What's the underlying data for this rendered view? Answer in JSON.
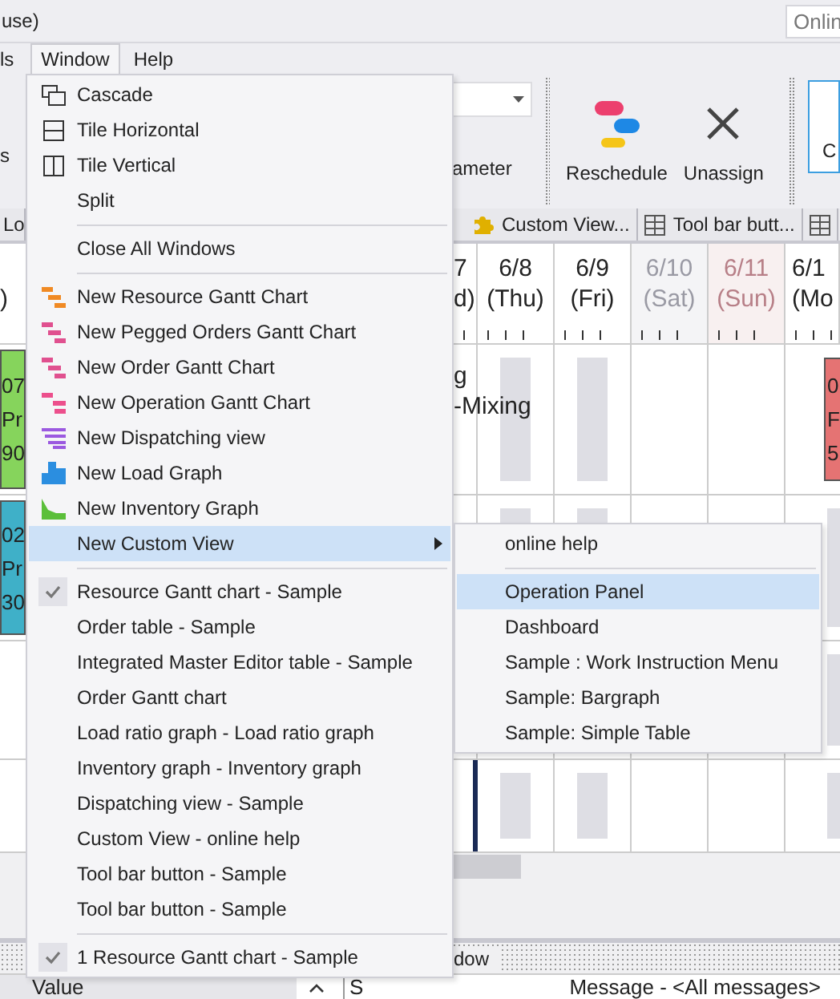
{
  "title_bar": {
    "text": "use)",
    "online_field": "Onlin"
  },
  "menubar": [
    {
      "label": "ls",
      "selected": false
    },
    {
      "label": "Window",
      "selected": true
    },
    {
      "label": "Help",
      "selected": false
    }
  ],
  "toolbar": {
    "left_fragment": "s",
    "param_fragment": "ameter",
    "buttons": [
      {
        "label": "Reschedule",
        "kind": "reschedule"
      },
      {
        "label": "Unassign",
        "kind": "unassign"
      },
      {
        "label": "C",
        "kind": "partial"
      }
    ]
  },
  "doc_tabs": [
    {
      "label": "Lo",
      "kind": "plain"
    },
    {
      "label": "Custom View...",
      "kind": "custom"
    },
    {
      "label": "Tool bar butt...",
      "kind": "table"
    },
    {
      "kind": "table"
    }
  ],
  "gantt": {
    "left_fragment": ")",
    "dates": [
      {
        "date": "7",
        "day": "d)",
        "kind": "weekday"
      },
      {
        "date": "6/8",
        "day": "(Thu)",
        "kind": "weekday"
      },
      {
        "date": "6/9",
        "day": "(Fri)",
        "kind": "weekday"
      },
      {
        "date": "6/10",
        "day": "(Sat)",
        "kind": "saturday"
      },
      {
        "date": "6/11",
        "day": "(Sun)",
        "kind": "sunday"
      },
      {
        "date": "6/1",
        "day": "(Mo",
        "kind": "weekday"
      }
    ],
    "rows": [
      {
        "left_bar": {
          "color": "#86d45c",
          "lines": [
            "07",
            "Pr",
            "90"
          ]
        },
        "texts": [
          "g",
          "-Mixing"
        ],
        "right_bar": {
          "color": "#e57373",
          "lines": [
            "0",
            "F",
            "5"
          ]
        }
      },
      {
        "left_bar": {
          "color": "#3fb0c8",
          "lines": [
            "02",
            "Pr",
            "30"
          ]
        }
      }
    ]
  },
  "dock_title": "dow",
  "bottom": {
    "value_header": "Value",
    "s_header": "S",
    "message": "Message - <All messages>"
  },
  "window_menu": {
    "sections": [
      [
        {
          "label": "Cascade",
          "kind": "cascade",
          "checked": false,
          "submenu": false,
          "selected": false
        },
        {
          "label": "Tile Horizontal",
          "kind": "tile-horizontal",
          "checked": false,
          "submenu": false,
          "selected": false
        },
        {
          "label": "Tile Vertical",
          "kind": "tile-vertical",
          "checked": false,
          "submenu": false,
          "selected": false
        },
        {
          "label": "Split",
          "kind": "plain",
          "checked": false,
          "submenu": false,
          "selected": false
        }
      ],
      [
        {
          "label": "Close All Windows",
          "kind": "plain",
          "checked": false,
          "submenu": false,
          "selected": false
        }
      ],
      [
        {
          "label": "New Resource Gantt Chart",
          "kind": "resource",
          "checked": false,
          "submenu": false,
          "selected": false
        },
        {
          "label": "New Pegged Orders Gantt Chart",
          "kind": "pegged",
          "checked": false,
          "submenu": false,
          "selected": false
        },
        {
          "label": "New Order Gantt Chart",
          "kind": "order",
          "checked": false,
          "submenu": false,
          "selected": false
        },
        {
          "label": "New Operation Gantt Chart",
          "kind": "operation",
          "checked": false,
          "submenu": false,
          "selected": false
        },
        {
          "label": "New Dispatching view",
          "kind": "dispatch",
          "checked": false,
          "submenu": false,
          "selected": false
        },
        {
          "label": "New Load Graph",
          "kind": "load",
          "checked": false,
          "submenu": false,
          "selected": false
        },
        {
          "label": "New Inventory Graph",
          "kind": "inventory",
          "checked": false,
          "submenu": false,
          "selected": false
        },
        {
          "label": "New Custom View",
          "kind": "plain",
          "checked": false,
          "submenu": true,
          "selected": true
        }
      ],
      [
        {
          "label": "Resource Gantt chart - Sample",
          "kind": "plain",
          "checked": true,
          "submenu": false,
          "selected": false
        },
        {
          "label": "Order table - Sample",
          "kind": "plain",
          "checked": false,
          "submenu": false,
          "selected": false
        },
        {
          "label": "Integrated Master Editor table - Sample",
          "kind": "plain",
          "checked": false,
          "submenu": false,
          "selected": false
        },
        {
          "label": "Order Gantt chart",
          "kind": "plain",
          "checked": false,
          "submenu": false,
          "selected": false
        },
        {
          "label": "Load ratio graph - Load ratio graph",
          "kind": "plain",
          "checked": false,
          "submenu": false,
          "selected": false
        },
        {
          "label": "Inventory graph - Inventory graph",
          "kind": "plain",
          "checked": false,
          "submenu": false,
          "selected": false
        },
        {
          "label": "Dispatching view - Sample",
          "kind": "plain",
          "checked": false,
          "submenu": false,
          "selected": false
        },
        {
          "label": "Custom View - online help",
          "kind": "plain",
          "checked": false,
          "submenu": false,
          "selected": false
        },
        {
          "label": "Tool bar button - Sample",
          "kind": "plain",
          "checked": false,
          "submenu": false,
          "selected": false
        },
        {
          "label": "Tool bar button - Sample",
          "kind": "plain",
          "checked": false,
          "submenu": false,
          "selected": false
        }
      ],
      [
        {
          "label": "1 Resource Gantt chart - Sample",
          "kind": "plain",
          "checked": true,
          "submenu": false,
          "selected": false
        }
      ]
    ]
  },
  "custom_view_submenu": {
    "sections": [
      [
        {
          "label": "online help",
          "selected": false
        }
      ],
      [
        {
          "label": "Operation Panel",
          "selected": true
        },
        {
          "label": "Dashboard",
          "selected": false
        },
        {
          "label": "Sample : Work Instruction Menu",
          "selected": false
        },
        {
          "label": "Sample: Bargraph",
          "selected": false
        },
        {
          "label": "Sample: Simple Table",
          "selected": false
        }
      ]
    ]
  }
}
